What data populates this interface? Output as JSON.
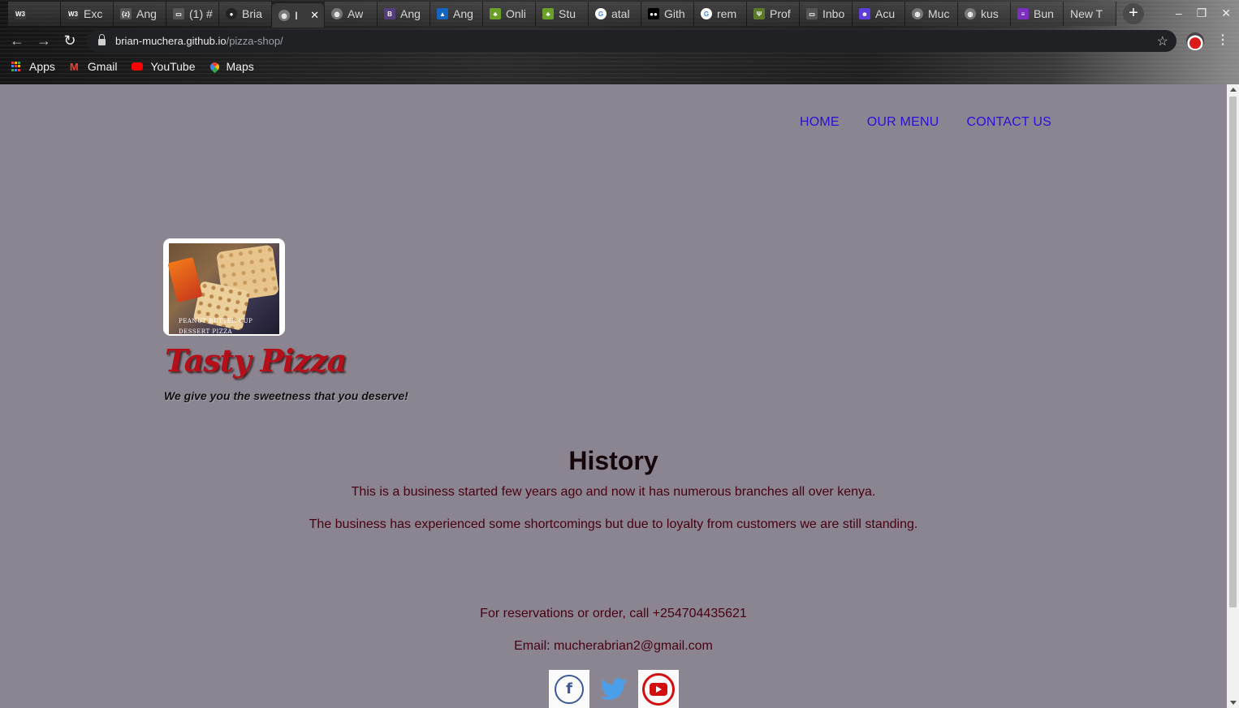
{
  "browser": {
    "tabs": [
      {
        "title": "",
        "icon": "w3schools-icon",
        "color": "#3a3a3a"
      },
      {
        "title": "Exc",
        "icon": "w3schools-icon",
        "color": "#3a3a3a"
      },
      {
        "title": "Ang",
        "icon": "code-icon",
        "color": "#555"
      },
      {
        "title": "(1) #",
        "icon": "folder-icon",
        "color": "#555"
      },
      {
        "title": "Bria",
        "icon": "github-icon",
        "color": "#222"
      },
      {
        "title": "I",
        "icon": "globe-icon",
        "color": "#777",
        "active": true
      },
      {
        "title": "Aw",
        "icon": "globe-icon",
        "color": "#777"
      },
      {
        "title": "Ang",
        "icon": "bootstrap-icon",
        "color": "#563d7c"
      },
      {
        "title": "Ang",
        "icon": "angular-icon",
        "color": "#1565c0"
      },
      {
        "title": "Onli",
        "icon": "tree-icon",
        "color": "#6a9f2a"
      },
      {
        "title": "Stu",
        "icon": "tree-icon",
        "color": "#6a9f2a"
      },
      {
        "title": "atal",
        "icon": "google-icon",
        "color": "#4285f4"
      },
      {
        "title": "Gith",
        "icon": "medium-icon",
        "color": "#000"
      },
      {
        "title": "rem",
        "icon": "google-icon",
        "color": "#4285f4"
      },
      {
        "title": "Prof",
        "icon": "palm-icon",
        "color": "#5a7a2a"
      },
      {
        "title": "Inbo",
        "icon": "folder-icon",
        "color": "#555"
      },
      {
        "title": "Acu",
        "icon": "user-icon",
        "color": "#5c3dd8"
      },
      {
        "title": "Muc",
        "icon": "globe-icon",
        "color": "#777"
      },
      {
        "title": "kus",
        "icon": "globe-icon",
        "color": "#777"
      },
      {
        "title": "Bun",
        "icon": "list-icon",
        "color": "#7b2fbf"
      },
      {
        "title": "New T",
        "icon": "",
        "color": "#555"
      }
    ],
    "url_host": "brian-muchera.github.io",
    "url_path": "/pizza-shop/",
    "bookmarks": [
      {
        "label": "Apps",
        "icon": "apps-grid-icon"
      },
      {
        "label": "Gmail",
        "icon": "gmail-icon"
      },
      {
        "label": "YouTube",
        "icon": "youtube-icon"
      },
      {
        "label": "Maps",
        "icon": "maps-icon"
      }
    ]
  },
  "site": {
    "nav": {
      "home": "HOME",
      "menu": "OUR MENU",
      "contact": "CONTACT US"
    },
    "logo_caption_line1": "PEANUT BUTTER CUP",
    "logo_caption_line2": "DESSERT PIZZA",
    "brand": "Tasty Pizza",
    "tagline": "We give you the sweetness that you deserve!",
    "history": {
      "title": "History",
      "p1": "This is a business started few years ago and now it has numerous branches all over kenya.",
      "p2": "The business has experienced some shortcomings but due to loyalty from customers we are still standing."
    },
    "contact": {
      "phone_line": "For reservations or order, call +254704435621",
      "email_line": "Email: mucherabrian2@gmail.com"
    },
    "social": [
      "facebook",
      "twitter",
      "youtube"
    ]
  },
  "colors": {
    "page_bg": "#8b8592",
    "nav_link": "#2a0fd8",
    "brand": "#b5101a",
    "body_text": "#4a0010"
  }
}
